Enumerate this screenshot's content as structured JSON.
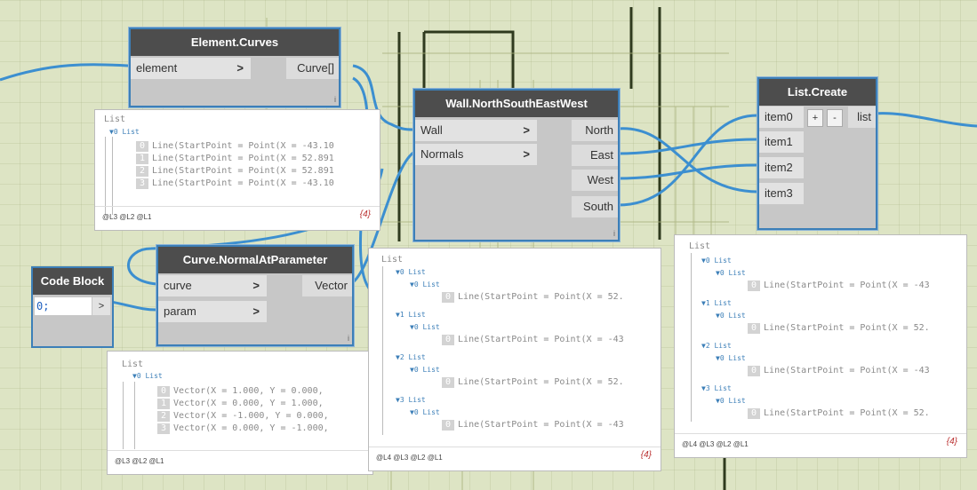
{
  "nodes": {
    "element_curves": {
      "title": "Element.Curves",
      "inputs": [
        "element"
      ],
      "outputs": [
        "Curve[]"
      ]
    },
    "wall_nsew": {
      "title": "Wall.NorthSouthEastWest",
      "inputs": [
        "Wall",
        "Normals"
      ],
      "outputs": [
        "North",
        "East",
        "West",
        "South"
      ]
    },
    "list_create": {
      "title": "List.Create",
      "inputs": [
        "item0",
        "item1",
        "item2",
        "item3"
      ],
      "outputs": [
        "list"
      ],
      "add_label": "+",
      "remove_label": "-"
    },
    "curve_normal": {
      "title": "Curve.NormalAtParameter",
      "inputs": [
        "curve",
        "param"
      ],
      "outputs": [
        "Vector"
      ]
    },
    "code_block": {
      "title": "Code Block",
      "code": "0;",
      "output": ">"
    }
  },
  "arrow_glyph": ">",
  "resize_glyph": "i",
  "previews": {
    "curves": {
      "lines": [
        "List",
        "▼0 List",
        "0",
        "Line(StartPoint = Point(X = -43.10",
        "1",
        "Line(StartPoint = Point(X = 52.891",
        "2",
        "Line(StartPoint = Point(X = 52.891",
        "3",
        "Line(StartPoint = Point(X = -43.10"
      ],
      "levels": "@L3 @L2 @L1",
      "count": "{4}"
    },
    "vectors": {
      "lines": [
        "List",
        "▼0 List",
        "0",
        "Vector(X = 1.000, Y = 0.000,",
        "1",
        "Vector(X = 0.000, Y = 1.000,",
        "2",
        "Vector(X = -1.000, Y = 0.000,",
        "3",
        "Vector(X = 0.000, Y = -1.000,"
      ],
      "levels": "@L3 @L2 @L1"
    },
    "wall": {
      "lines": [
        "List",
        "▼0 List",
        "▼0 List",
        "0",
        "Line(StartPoint = Point(X = 52.",
        "▼1 List",
        "▼0 List",
        "0",
        "Line(StartPoint = Point(X = -43",
        "▼2 List",
        "▼0 List",
        "0",
        "Line(StartPoint = Point(X = 52.",
        "▼3 List",
        "▼0 List",
        "0",
        "Line(StartPoint = Point(X = -43"
      ],
      "levels": "@L4 @L3 @L2 @L1",
      "count": "{4}"
    },
    "list": {
      "lines": [
        "List",
        "▼0 List",
        "▼0 List",
        "0",
        "Line(StartPoint = Point(X = -43",
        "▼1 List",
        "▼0 List",
        "0",
        "Line(StartPoint = Point(X = 52.",
        "▼2 List",
        "▼0 List",
        "0",
        "Line(StartPoint = Point(X = -43",
        "▼3 List",
        "▼0 List",
        "0",
        "Line(StartPoint = Point(X = 52."
      ],
      "levels": "@L4 @L3 @L2 @L1",
      "count": "{4}"
    }
  },
  "colors": {
    "wire": "#3c8fd0",
    "node_border": "#3c7fb8",
    "title_bg": "#4d4d4d",
    "canvas": "#dde4c4"
  }
}
